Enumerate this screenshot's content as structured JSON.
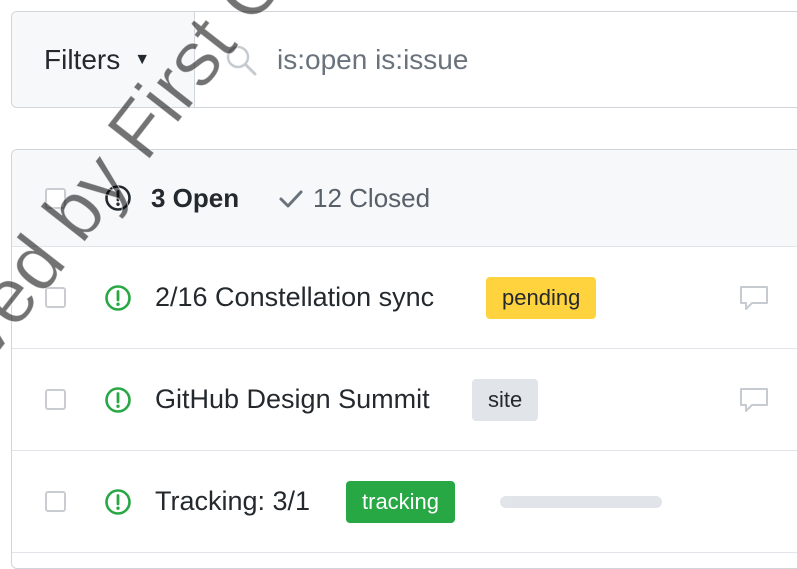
{
  "filters": {
    "label": "Filters"
  },
  "search": {
    "value": "is:open is:issue"
  },
  "issues_header": {
    "open_count": "3 Open",
    "closed_count": "12 Closed"
  },
  "issues": [
    {
      "title": "2/16 Constellation sync",
      "label": "pending",
      "label_color": "#ffd33d",
      "has_comment_icon": true
    },
    {
      "title": "GitHub Design Summit",
      "label": "site",
      "label_color": "#e1e4e8",
      "has_comment_icon": true
    },
    {
      "title": "Tracking: 3/1",
      "label": "tracking",
      "label_color": "#28a745",
      "has_progress_bar": true
    }
  ],
  "icons": {
    "filters_caret": "caret-down-icon",
    "search": "search-icon",
    "open_state": "issue-opened-icon",
    "closed_state": "check-icon",
    "comment": "comment-icon"
  },
  "colors": {
    "open_green": "#28a745",
    "closed_gray": "#6a737d"
  },
  "watermark": {
    "text": "ved by First Circuit Li"
  }
}
